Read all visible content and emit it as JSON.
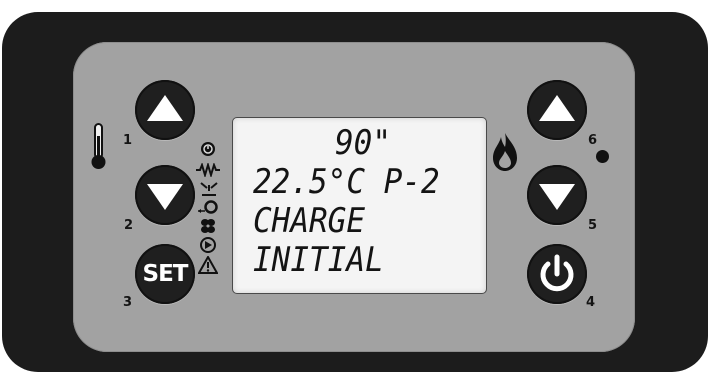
{
  "display": {
    "line1": "90\"",
    "line2": "22.5°C P-2",
    "line3": "CHARGE",
    "line4": "INITIAL"
  },
  "buttons": {
    "b1": {
      "number": "1",
      "icon": "up-arrow"
    },
    "b2": {
      "number": "2",
      "icon": "down-arrow"
    },
    "b3": {
      "number": "3",
      "label": "SET"
    },
    "b4": {
      "number": "4",
      "icon": "power"
    },
    "b5": {
      "number": "5",
      "icon": "down-arrow"
    },
    "b6": {
      "number": "6",
      "icon": "up-arrow"
    }
  },
  "indicators": [
    "thermometer",
    "clock",
    "resistor-heater",
    "spark",
    "ignition",
    "fan",
    "pump",
    "alarm-triangle",
    "flame",
    "status-led"
  ],
  "colors": {
    "bezel": "#1c1c1c",
    "panel": "#a2a2a2",
    "button": "#1f1f1f",
    "lcd": "#f4f4f4"
  }
}
